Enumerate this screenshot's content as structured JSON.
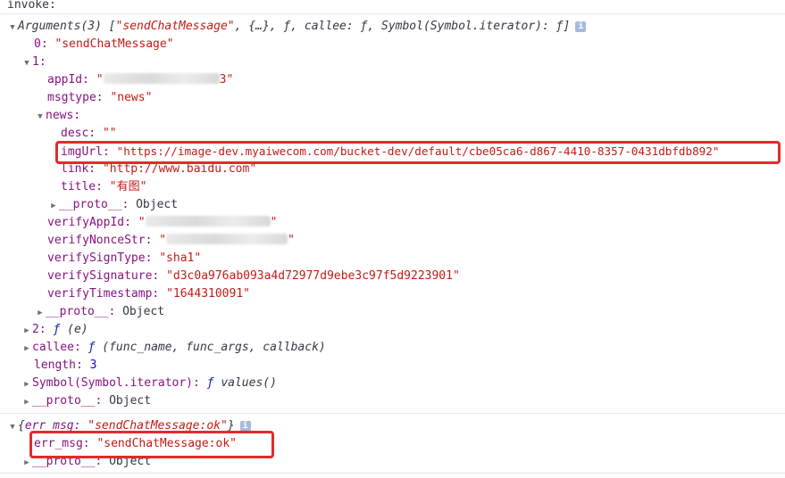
{
  "header_label": "invoke:",
  "args_summary": {
    "prefix": "Arguments(3) [",
    "first": "\"sendChatMessage\"",
    "rest": ", {…}, ƒ, callee: ƒ, Symbol(Symbol.iterator): ƒ]"
  },
  "arg0": {
    "key": "0:",
    "value": "\"sendChatMessage\""
  },
  "arg1_key": "1:",
  "appId": {
    "key": "appId:",
    "value_start": "\"",
    "value_end": "3\""
  },
  "msgtype": {
    "key": "msgtype:",
    "value": "\"news\""
  },
  "news_key": "news:",
  "desc": {
    "key": "desc:",
    "value": "\"\""
  },
  "imgUrl": {
    "key": "imgUrl:",
    "value": "\"https://image-dev.myaiwecom.com/bucket-dev/default/cbe05ca6-d867-4410-8357-0431dbfdb892\""
  },
  "link": {
    "key": "link:",
    "value": "\"http://www.baidu.com\""
  },
  "title": {
    "key": "title:",
    "value": "\"有图\""
  },
  "proto": {
    "key": "__proto__:",
    "value": "Object"
  },
  "verifyAppId": {
    "key": "verifyAppId:",
    "value_start": "\"",
    "value_end": "\""
  },
  "verifyNonceStr": {
    "key": "verifyNonceStr:",
    "value_start": "\"",
    "value_end": "\""
  },
  "verifySignType": {
    "key": "verifySignType:",
    "value": "\"sha1\""
  },
  "verifySignature": {
    "key": "verifySignature:",
    "value": "\"d3c0a976ab093a4d72977d9ebe3c97f5d9223901\""
  },
  "verifyTimestamp": {
    "key": "verifyTimestamp:",
    "value": "\"1644310091\""
  },
  "arg2": {
    "key": "2:",
    "f": "ƒ",
    "sig": "(e)"
  },
  "callee": {
    "key": "callee:",
    "f": "ƒ",
    "sig": "(func_name, func_args, callback)"
  },
  "length": {
    "key": "length:",
    "value": "3"
  },
  "symbol": {
    "key": "Symbol(Symbol.iterator):",
    "f": "ƒ",
    "sig": "values()"
  },
  "result": {
    "summary_open": "{",
    "summary_key": "err_msg:",
    "summary_value": "\"sendChatMessage:ok\"",
    "summary_close": "}",
    "err_key": "err_msg:",
    "err_value": "\"sendChatMessage:ok\""
  },
  "info_icon_glyph": "i",
  "colors": {
    "key": "#881280",
    "string": "#c41a16",
    "number": "#1c00cf",
    "function": "#0d22aa",
    "highlight": "#e52a2a"
  }
}
